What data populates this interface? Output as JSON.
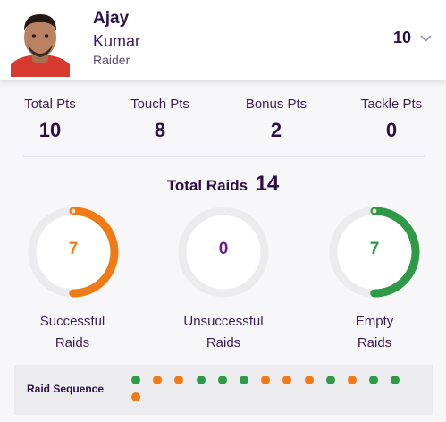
{
  "player": {
    "first_name": "Ajay",
    "last_name": "Kumar",
    "role": "Raider",
    "jersey": "10",
    "avatar_icon": "player-photo"
  },
  "stats": [
    {
      "label": "Total Pts",
      "value": "10"
    },
    {
      "label": "Touch Pts",
      "value": "8"
    },
    {
      "label": "Bonus Pts",
      "value": "2"
    },
    {
      "label": "Tackle Pts",
      "value": "0"
    }
  ],
  "raids": {
    "total_label": "Total Raids",
    "total_value": "14",
    "gauges": [
      {
        "value": "7",
        "fraction": 0.5,
        "label_line1": "Successful",
        "label_line2": "Raids",
        "color": "#f07a16"
      },
      {
        "value": "0",
        "fraction": 0,
        "label_line1": "Unsuccessful",
        "label_line2": "Raids",
        "color": "#6a1f82"
      },
      {
        "value": "7",
        "fraction": 0.5,
        "label_line1": "Empty",
        "label_line2": "Raids",
        "color": "#2e9a48"
      }
    ]
  },
  "sequence": {
    "label": "Raid Sequence",
    "raids": [
      "empty",
      "successful",
      "successful",
      "empty",
      "empty",
      "empty",
      "successful",
      "successful",
      "successful",
      "empty",
      "successful",
      "empty",
      "empty",
      "successful"
    ]
  },
  "colors": {
    "successful": "#f07a16",
    "empty": "#2e9a48",
    "unsuccessful": "#6a1f82",
    "title": "#2d0f46",
    "ring_track": "#ececee"
  }
}
